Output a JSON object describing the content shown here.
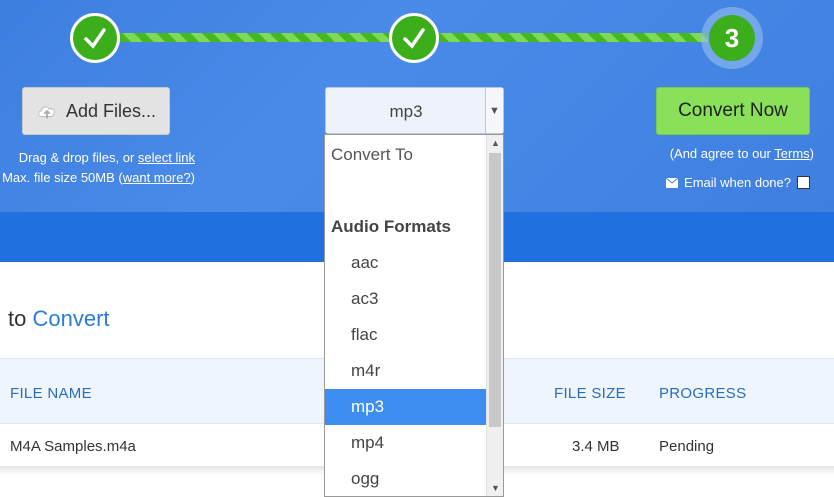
{
  "steps": {
    "step1_icon": "check-icon",
    "step2_icon": "check-icon",
    "step3_label": "3"
  },
  "upload": {
    "add_files_label": "Add Files...",
    "drag_text": "Drag & drop files, or",
    "select_link": "select link",
    "max_size_text": "Max. file size 50MB (",
    "want_more_link": "want more?",
    "max_size_close": ")"
  },
  "format_select": {
    "value": "mp3"
  },
  "dropdown": {
    "placeholder": "Convert To",
    "group_header": "Audio Formats",
    "options": [
      "aac",
      "ac3",
      "flac",
      "m4r",
      "mp3",
      "mp4",
      "ogg"
    ],
    "selected": "mp3"
  },
  "convert": {
    "button_label": "Convert Now",
    "agree_prefix": "(And agree to our ",
    "terms_link": "Terms",
    "agree_suffix": ")",
    "email_label": "Email when done?"
  },
  "files_section": {
    "title_prefix": "to",
    "title_accent": "Convert",
    "columns": {
      "file_name": "FILE NAME",
      "file_size": "FILE SIZE",
      "progress": "PROGRESS"
    },
    "rows": [
      {
        "file_name": "M4A Samples.m4a",
        "file_size": "3.4 MB",
        "progress": "Pending"
      }
    ]
  },
  "colors": {
    "header_blue": "#4a8ae8",
    "step_green": "#3cae1c",
    "convert_green": "#8be05a",
    "selected_blue": "#3d8ef0"
  }
}
